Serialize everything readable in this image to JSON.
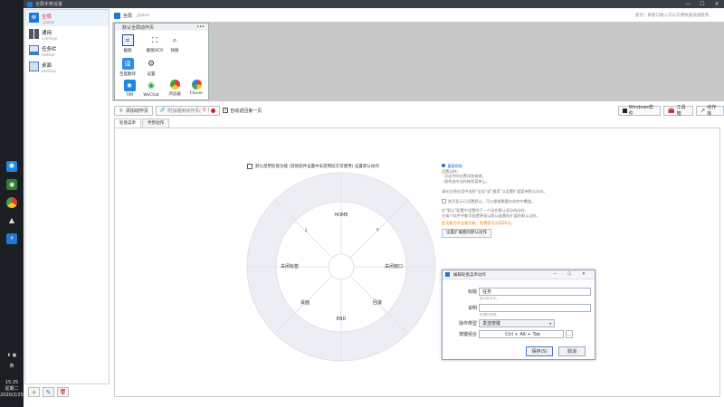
{
  "window": {
    "title": "全局手势设置"
  },
  "taskbar": {
    "icons": [
      "star-icon",
      "wechat-icon",
      "chrome-icon",
      "mortarboard-icon",
      "lightning-icon"
    ],
    "ime": "英",
    "time": "15:25",
    "weekday": "星期二",
    "date": "2020/2/25"
  },
  "sidebar": {
    "items": [
      {
        "name": "全局",
        "sub": "_global",
        "selected": true
      },
      {
        "name": "通用",
        "sub": "common"
      },
      {
        "name": "任务栏",
        "sub": "taskbar"
      },
      {
        "name": "桌面",
        "sub": "desktop"
      }
    ],
    "buttons": {
      "add": "+",
      "edit": "✎",
      "delete": "🗑"
    }
  },
  "topbar": {
    "name": "全局",
    "id": "_global",
    "tip": "提示：将窗口拖入可以方便快速添加程序。"
  },
  "menu_panel": {
    "title": "默认全局动作页",
    "items": [
      {
        "label": "截图"
      },
      {
        "label": "截图OCR"
      },
      {
        "label": "快搜"
      },
      {
        "label": "百度翻译"
      },
      {
        "label": "设置"
      },
      {
        "label": "TIM"
      },
      {
        "label": "WeChat"
      },
      {
        "label": "浏览器"
      },
      {
        "label": "Clover"
      }
    ]
  },
  "toolbar": {
    "add_action_page": "添加动作页",
    "add_associated_page": "附加通用动作页(",
    "associated_count": "0",
    "associated_suffix": ")",
    "auto_back_first": "自动返回第一页",
    "windows_software": "Windows软件",
    "toolbox": "工具箱",
    "action_library": "动作库"
  },
  "tabs": [
    {
      "label": "轮盘菜单",
      "selected": true
    },
    {
      "label": "手势动作"
    }
  ],
  "wheel": {
    "checkbox_label": "默认禁用轮盘功能 (其他软件设置中未禁用前方可使用) 设置默认动作",
    "sectors": [
      "HOME",
      "↑",
      "关闭窗口",
      "回滚",
      "END",
      "桌面",
      "关闭标签",
      "↓"
    ]
  },
  "help": {
    "heading": "重要帮助",
    "lines": [
      "设置动作：",
      "- 点击中间位置添加修改。",
      "- 规将选中动作拖到菜单上。",
      "",
      "请在左侧应用中选择\"全局\"或\"通用\"以设置扩展菜单默认动作。",
      "",
      "",
      "在\"默认\"配置中设置的下一个动作默认显示的动作，",
      "在每个软件中都可配置更改以默认配置的扩展的默认动作。"
    ],
    "checkbox_text": "首页显示已设置默认，可以根据需要在软件中覆盖。",
    "orange": "此功能为专业版功能，免费版可试用30天。",
    "button": "设置扩展圈的默认动作"
  },
  "dialog": {
    "title": "编辑轮盘菜单动作",
    "title_label": "标题",
    "title_value": "任务",
    "title_hint": "显示的文字。",
    "desc_label": "说明",
    "desc_hint": "可提供说明。",
    "op_label": "操作类型",
    "op_value": "发送按键",
    "hotkey_label": "按键组合",
    "hotkey_value": "Ctrl + Alt + Tab",
    "save": "保存(S)",
    "cancel": "取消"
  }
}
